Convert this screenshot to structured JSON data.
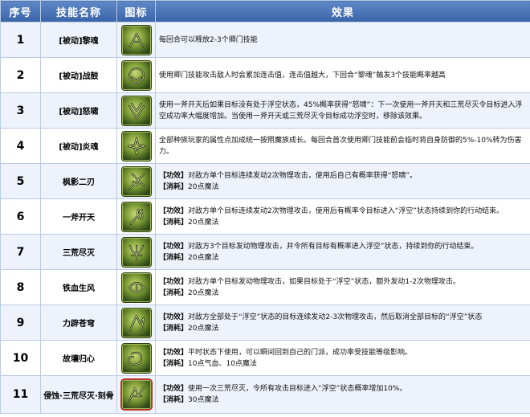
{
  "header": {
    "no": "序号",
    "name": "技能名称",
    "icon": "图标",
    "effect": "效果"
  },
  "rows": [
    {
      "no": "1",
      "name": "[被动]黎魂",
      "icon": "skill-icon",
      "effect": [
        "每回合可以释放2-3个卿门技能"
      ]
    },
    {
      "no": "2",
      "name": "[被动]战鼓",
      "icon": "skill-icon",
      "effect": [
        "使用卿门技能攻击敌人时会累加连击值，连击值越大，下回合“黎魂”触发3个技能概率越高"
      ]
    },
    {
      "no": "3",
      "name": "[被动]怒啸",
      "icon": "skill-icon",
      "effect": [
        "使用一斧开天后如果目标没有处于浮空状态，45%概率获得“怒啸”：下一次使用一斧开天和三荒尽灭令目标进入浮空成功率大幅度增加。当使用一斧开天或三荒尽灭令目标成功浮空时，移除该效果。"
      ]
    },
    {
      "no": "4",
      "name": "[被动]炎魂",
      "icon": "skill-icon",
      "effect": [
        "全部种族玩家的属性点加成统一按照魔族成长。每回合首次使用卿门技能前会临时将自身防御的5%-10%转为伤害力。"
      ]
    },
    {
      "no": "5",
      "name": "枫影二刃",
      "icon": "skill-icon",
      "effect_tag1": "【功效】",
      "effect_text1": "对敌方单个目标连续发动2次物理攻击，使用后自己有概率获得“怒啸”。",
      "effect_tag2": "【消耗】",
      "effect_text2": "20点魔法"
    },
    {
      "no": "6",
      "name": "一斧开天",
      "icon": "skill-icon",
      "effect_tag1": "【功效】",
      "effect_text1": "对敌方单个目标连续发动2次物理攻击，使用后有概率令目标进入“浮空”状态持续到你的行动结束。",
      "effect_tag2": "【消耗】",
      "effect_text2": "20点魔法"
    },
    {
      "no": "7",
      "name": "三荒尽灭",
      "icon": "skill-icon",
      "effect_tag1": "【功效】",
      "effect_text1": "对敌方3个目标发动物理攻击，并令所有目标有概率进入浮空”状态，持续到你的行动结束。",
      "effect_tag2": "【消耗】",
      "effect_text2": "20点魔法"
    },
    {
      "no": "8",
      "name": "铁血生风",
      "icon": "skill-icon",
      "effect_tag1": "【功效】",
      "effect_text1": "对敌方单个目标发动物理攻击，如果目标处于“浮空”状态，额外发动1-2次物理攻击。",
      "effect_tag2": "【消耗】",
      "effect_text2": "20点魔法"
    },
    {
      "no": "9",
      "name": "力辟苍穹",
      "icon": "skill-icon",
      "effect_tag1": "【功效】",
      "effect_text1": "对敌方全部处于“浮空”状态的目标连续发动2-3次物理攻击，然后取消全部目标的“浮空”状态",
      "effect_tag2": "【消耗】",
      "effect_text2": "20点魔法"
    },
    {
      "no": "10",
      "name": "故壤归心",
      "icon": "skill-icon",
      "effect_tag1": "【功效】",
      "effect_text1": "平时状态下使用，可以瞬间回到自己的门派，成功率受技能等级影响。",
      "effect_tag2": "【消耗】",
      "effect_text2": "10点气血、10点魔法"
    },
    {
      "no": "11",
      "name": "侵蚀·三荒尽灭·刻骨",
      "icon": "skill-icon",
      "effect_tag1": "【功效】",
      "effect_text1": "使用一次三荒尽灭，令所有攻击目标进入“浮空”状态概率增加10%。",
      "effect_tag2": "【消耗】",
      "effect_text2": "30点魔法"
    }
  ]
}
